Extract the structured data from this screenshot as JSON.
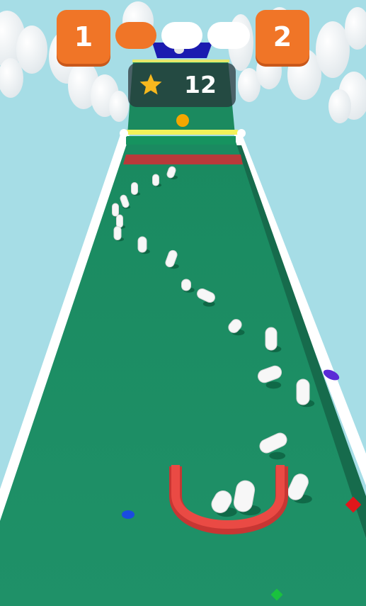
{
  "hud": {
    "current_level": "1",
    "next_level": "2",
    "progress_segments_total": 3,
    "progress_segments_done": 1,
    "score": "12"
  },
  "colors": {
    "sky": "#a6dde6",
    "track": "#1e8f66",
    "rail": "#ffffff",
    "accent_orange": "#f07527",
    "scoop_red": "#e8433e",
    "finish_blue": "#1b1bb0",
    "star": "#f7b81e"
  },
  "icons": [
    "star-icon",
    "cloud-icon",
    "pin-icon",
    "scoop-icon",
    "gem-icon",
    "coin-icon"
  ]
}
